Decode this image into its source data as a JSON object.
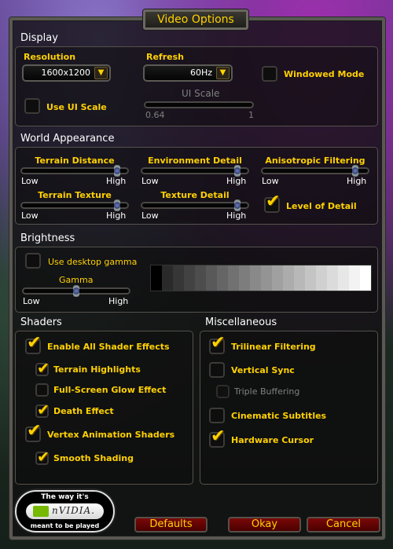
{
  "title": "Video Options",
  "display": {
    "section_title": "Display",
    "resolution_label": "Resolution",
    "resolution_value": "1600x1200",
    "refresh_label": "Refresh",
    "refresh_value": "60Hz",
    "windowed_mode_label": "Windowed Mode",
    "windowed_mode_checked": false,
    "use_ui_scale_label": "Use UI Scale",
    "use_ui_scale_checked": false,
    "ui_scale_label": "UI Scale",
    "ui_scale_min": "0.64",
    "ui_scale_max": "1"
  },
  "world": {
    "section_title": "World Appearance",
    "sliders": [
      {
        "label": "Terrain Distance",
        "low": "Low",
        "high": "High",
        "value": 0.9
      },
      {
        "label": "Environment Detail",
        "low": "Low",
        "high": "High",
        "value": 0.9
      },
      {
        "label": "Anisotropic Filtering",
        "low": "Low",
        "high": "High",
        "value": 0.88
      },
      {
        "label": "Terrain Texture",
        "low": "Low",
        "high": "High",
        "value": 0.9
      },
      {
        "label": "Texture Detail",
        "low": "Low",
        "high": "High",
        "value": 0.9
      }
    ],
    "level_of_detail_label": "Level of Detail",
    "level_of_detail_checked": true
  },
  "brightness": {
    "section_title": "Brightness",
    "desktop_gamma_label": "Use desktop gamma",
    "desktop_gamma_checked": false,
    "gamma_label": "Gamma",
    "gamma_low": "Low",
    "gamma_high": "High",
    "gamma_value": 0.5
  },
  "shaders": {
    "section_title": "Shaders",
    "items": [
      {
        "label": "Enable All Shader Effects",
        "checked": true
      },
      {
        "label": "Terrain Highlights",
        "checked": true
      },
      {
        "label": "Full-Screen Glow Effect",
        "checked": false
      },
      {
        "label": "Death Effect",
        "checked": true
      },
      {
        "label": "Vertex Animation Shaders",
        "checked": true
      },
      {
        "label": "Smooth Shading",
        "checked": true
      }
    ]
  },
  "misc": {
    "section_title": "Miscellaneous",
    "items": [
      {
        "label": "Trilinear Filtering",
        "checked": true
      },
      {
        "label": "Vertical Sync",
        "checked": false
      },
      {
        "label": "Triple Buffering",
        "checked": false,
        "disabled": true
      },
      {
        "label": "Cinematic Subtitles",
        "checked": false
      },
      {
        "label": "Hardware Cursor",
        "checked": true
      }
    ]
  },
  "logo": {
    "top": "The way it's",
    "brand": "nVIDIA.",
    "bottom": "meant to be played"
  },
  "buttons": {
    "defaults": "Defaults",
    "okay": "Okay",
    "cancel": "Cancel"
  },
  "colors": {
    "gold": "#ffd100",
    "button_red": "#6a0404"
  },
  "tick_glyph": "✔",
  "arrow_glyph": "▼"
}
